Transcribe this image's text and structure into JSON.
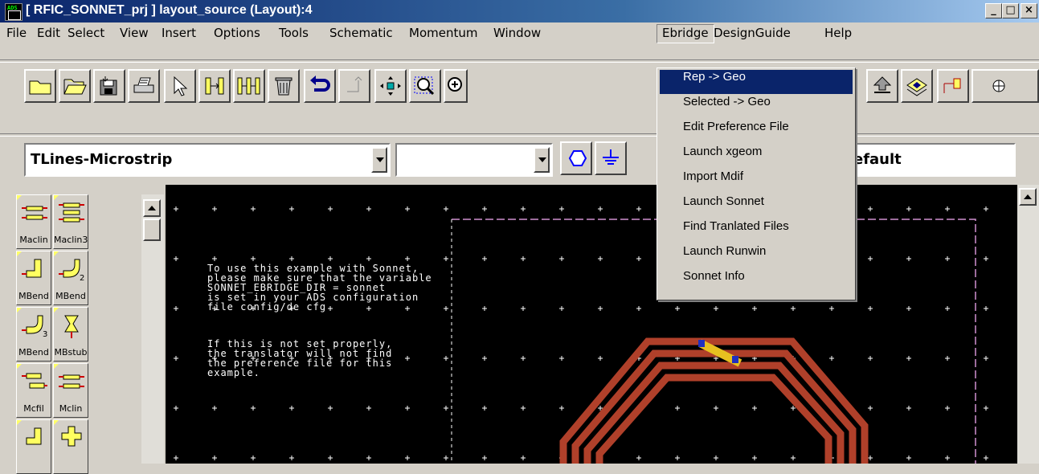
{
  "window": {
    "title": "[ RFIC_SONNET_prj ] layout_source (Layout):4",
    "controls": [
      "_",
      "□",
      "×"
    ]
  },
  "menubar": [
    "File",
    "Edit",
    "Select",
    "View",
    "Insert",
    "Options",
    "Tools",
    "Schematic",
    "Momentum",
    "Window",
    "Ebridge",
    "DesignGuide",
    "Help"
  ],
  "toolbar": {
    "icons": [
      "folder-icon",
      "open-folder-icon",
      "save-icon",
      "print-icon",
      "pointer-icon",
      "insert-pin-icon",
      "insert-ports-icon",
      "delete-icon",
      "undo-icon",
      "redo-icon",
      "move-icon",
      "zoom-area-icon",
      "zoom-in-icon"
    ],
    "icons_right": [
      "layer-up-icon",
      "layer-view-icon",
      "component-icon",
      "route-icon"
    ]
  },
  "palette_combo": {
    "value": "TLines-Microstrip"
  },
  "component_combo": {
    "value": ""
  },
  "layer_combo": {
    "value": "efault"
  },
  "palette": {
    "items": [
      {
        "label": "Maclin"
      },
      {
        "label": "Maclin3"
      },
      {
        "label": "MBend"
      },
      {
        "label": "MBend"
      },
      {
        "label": "MBend"
      },
      {
        "label": "MBstub"
      },
      {
        "label": "Mcfil"
      },
      {
        "label": "Mclin"
      }
    ]
  },
  "canvas": {
    "note_1": "To use this example with Sonnet,\nplease make sure that the variable\nSONNET_EBRIDGE_DIR = sonnet\nis set in your ADS configuration\nfile config/de cfg",
    "note_2": "If this is not set properly,\nthe translator will not find\nthe preference file for this\nexample."
  },
  "ebridge_menu": {
    "items": [
      {
        "label": "Rep -> Geo",
        "selected": true
      },
      {
        "label": "Selected -> Geo"
      },
      {
        "label": "Edit Preference File"
      },
      {
        "label": "Launch xgeom"
      },
      {
        "label": "Import Mdif"
      },
      {
        "label": "Launch Sonnet"
      },
      {
        "label": "Find Tranlated Files"
      },
      {
        "label": "Launch Runwin"
      },
      {
        "label": "Sonnet Info"
      }
    ]
  },
  "colors": {
    "selection": "#0a246a",
    "trace": "#b0402a",
    "boundary": "#d090d0"
  }
}
